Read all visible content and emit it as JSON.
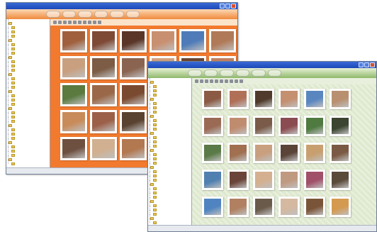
{
  "windows": [
    {
      "theme": "orange",
      "title": "",
      "menu": [
        {
          "label": "",
          "icon": "menu-button"
        },
        {
          "label": "",
          "icon": "menu-button"
        },
        {
          "label": "",
          "icon": "menu-button"
        },
        {
          "label": "",
          "icon": "menu-button"
        },
        {
          "label": "",
          "icon": "menu-button"
        },
        {
          "label": "",
          "icon": "menu-button"
        }
      ],
      "tree_items": [
        "",
        "",
        "",
        "",
        "",
        "",
        "",
        "",
        "",
        "",
        "",
        "",
        "",
        "",
        "",
        "",
        "",
        "",
        "",
        "",
        "",
        "",
        "",
        "",
        "",
        "",
        "",
        "",
        "",
        "",
        "",
        "",
        "",
        ""
      ],
      "photos": [
        "#a0603e",
        "#7e4a36",
        "#5a3628",
        "#c89070",
        "#4f7cb8",
        "#b07a58",
        "#c8a080",
        "#7c5c44",
        "#8a6450",
        "#d0a080",
        "#6a4632",
        "#c08060",
        "#5a7a40",
        "#9a6848",
        "#7a4a30",
        "#c0906a",
        "#d49a6a",
        "#8a5840",
        "#c88c5a",
        "#9c6048",
        "#5a4230",
        "#b48c70",
        "#aa7a54",
        "#c05a3c",
        "#6e5040",
        "#d0b090",
        "#b27850",
        "#7a5a40",
        "#9a7458",
        "#c09878"
      ]
    },
    {
      "theme": "green",
      "title": "",
      "menu": [
        {
          "label": "",
          "icon": "menu-button"
        },
        {
          "label": "",
          "icon": "menu-button"
        },
        {
          "label": "",
          "icon": "menu-button"
        },
        {
          "label": "",
          "icon": "menu-button"
        },
        {
          "label": "",
          "icon": "menu-button"
        },
        {
          "label": "",
          "icon": "menu-button"
        }
      ],
      "tree_items": [
        "",
        "",
        "",
        "",
        "",
        "",
        "",
        "",
        "",
        "",
        "",
        "",
        "",
        "",
        "",
        "",
        "",
        "",
        "",
        "",
        "",
        "",
        "",
        "",
        "",
        "",
        "",
        "",
        "",
        "",
        "",
        "",
        "",
        ""
      ],
      "photos": [
        "#8a5a44",
        "#b07058",
        "#4f3a2c",
        "#c49070",
        "#5a86c0",
        "#b89070",
        "#9a6a54",
        "#c08c70",
        "#7a5a48",
        "#8a4c50",
        "#4f7a40",
        "#3a4430",
        "#5a7a48",
        "#a07050",
        "#c8a080",
        "#5a4438",
        "#c8a070",
        "#7a5a44",
        "#4f80b0",
        "#6a4438",
        "#d4b090",
        "#c09a80",
        "#a05068",
        "#5a4a3a",
        "#4f84c0",
        "#b08060",
        "#6a5a4a",
        "#d4b8a0",
        "#7a5438",
        "#d49a50"
      ]
    }
  ]
}
